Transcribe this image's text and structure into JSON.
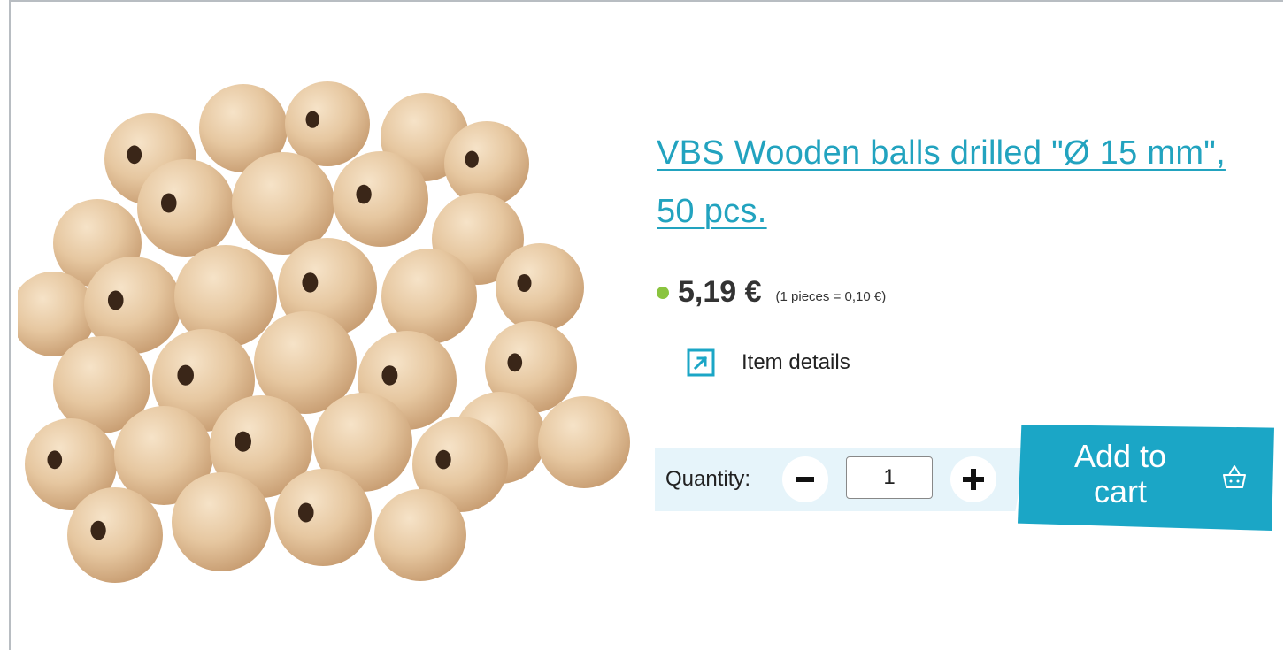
{
  "product": {
    "title": "VBS Wooden balls drilled \"Ø 15 mm\", 50 pcs.",
    "price": "5,19 €",
    "unit_price": "(1 pieces = 0,10 €)",
    "availability_color": "#8ac43f",
    "image_icon": "wooden-balls-image"
  },
  "details_link": {
    "label": "Item details",
    "icon": "external-link-icon"
  },
  "quantity": {
    "label": "Quantity:",
    "value": "1",
    "minus_icon": "minus-icon",
    "plus_icon": "plus-icon"
  },
  "cart": {
    "label": "Add to cart",
    "icon": "basket-icon"
  },
  "colors": {
    "accent": "#1ba6c6",
    "title": "#22a3bf",
    "band": "#e6f4fa"
  }
}
